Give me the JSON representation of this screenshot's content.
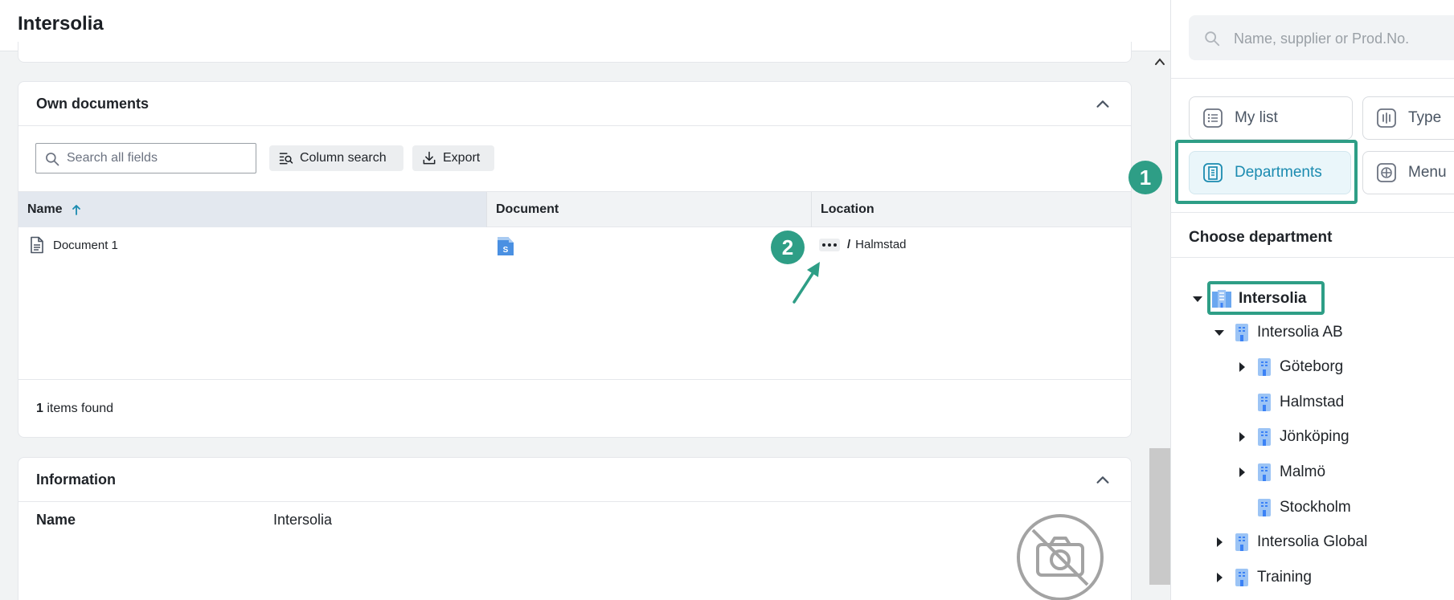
{
  "app": {
    "title": "Intersolia"
  },
  "own_documents": {
    "title": "Own documents",
    "search_placeholder": "Search all fields",
    "column_search_label": "Column search",
    "export_label": "Export",
    "columns": {
      "name": "Name",
      "document": "Document",
      "location": "Location"
    },
    "rows": [
      {
        "name": "Document 1",
        "location": "Halmstad"
      }
    ],
    "items_count": "1",
    "items_suffix": " items found"
  },
  "information": {
    "title": "Information",
    "name_label": "Name",
    "name_value": "Intersolia"
  },
  "sidebar": {
    "search_placeholder": "Name, supplier or Prod.No.",
    "tabs": {
      "my_list": "My list",
      "type": "Type",
      "departments": "Departments",
      "menu": "Menu"
    },
    "choose_department_title": "Choose department",
    "tree": [
      {
        "label": "Intersolia"
      },
      {
        "label": "Intersolia AB"
      },
      {
        "label": "Göteborg"
      },
      {
        "label": "Halmstad"
      },
      {
        "label": "Jönköping"
      },
      {
        "label": "Malmö"
      },
      {
        "label": "Stockholm"
      },
      {
        "label": "Intersolia Global"
      },
      {
        "label": "Training"
      }
    ]
  },
  "annotations": {
    "step1": "1",
    "step2": "2"
  },
  "colors": {
    "accent": "#1b8bb0",
    "annotation": "#2e9e86"
  }
}
